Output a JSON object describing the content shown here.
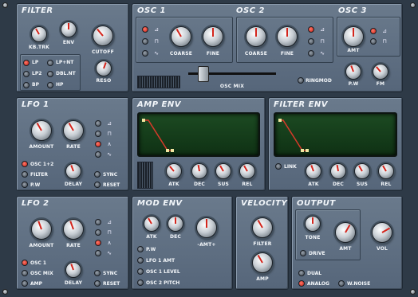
{
  "filter": {
    "title": "FILTER",
    "kbtrk": "KB.TRK",
    "env": "ENV",
    "cutoff": "CUTOFF",
    "reso": "RESO",
    "modes": [
      "LP",
      "LP+NT",
      "LP2",
      "DBL.NT",
      "BP",
      "HP"
    ]
  },
  "osc1": {
    "title": "OSC 1",
    "coarse": "COARSE",
    "fine": "FINE"
  },
  "osc2": {
    "title": "OSC 2",
    "coarse": "COARSE",
    "fine": "FINE"
  },
  "osc3": {
    "title": "OSC 3",
    "amt": "AMT",
    "pw": "P.W",
    "fm": "FM"
  },
  "oscmix": {
    "label": "OSC MIX",
    "ringmod": "RINGMOD"
  },
  "lfo1": {
    "title": "LFO 1",
    "amount": "AMOUNT",
    "rate": "RATE",
    "delay": "DELAY",
    "targets": [
      "OSC 1+2",
      "FILTER",
      "P.W"
    ],
    "sync": "SYNC",
    "reset": "RESET"
  },
  "ampenv": {
    "title": "AMP ENV",
    "atk": "ATK",
    "dec": "DEC",
    "sus": "SUS",
    "rel": "REL"
  },
  "filterenv": {
    "title": "FILTER ENV",
    "link": "LINK",
    "atk": "ATK",
    "dec": "DEC",
    "sus": "SUS",
    "rel": "REL"
  },
  "lfo2": {
    "title": "LFO 2",
    "amount": "AMOUNT",
    "rate": "RATE",
    "delay": "DELAY",
    "targets": [
      "OSC 1",
      "OSC MIX",
      "AMP"
    ],
    "sync": "SYNC",
    "reset": "RESET"
  },
  "modenv": {
    "title": "MOD ENV",
    "atk": "ATK",
    "dec": "DEC",
    "amt": "-AMT+",
    "targets": [
      "P.W",
      "LFO 1 AMT",
      "OSC 1 LEVEL",
      "OSC 2 PITCH"
    ]
  },
  "velocity": {
    "title": "VELOCITY",
    "filter": "FILTER",
    "amp": "AMP"
  },
  "output": {
    "title": "OUTPUT",
    "tone": "TONE",
    "amt": "AMT",
    "vol": "VOL",
    "drive": "DRIVE",
    "dual": "DUAL",
    "analog": "ANALOG",
    "wnoise": "W.NOISE"
  }
}
